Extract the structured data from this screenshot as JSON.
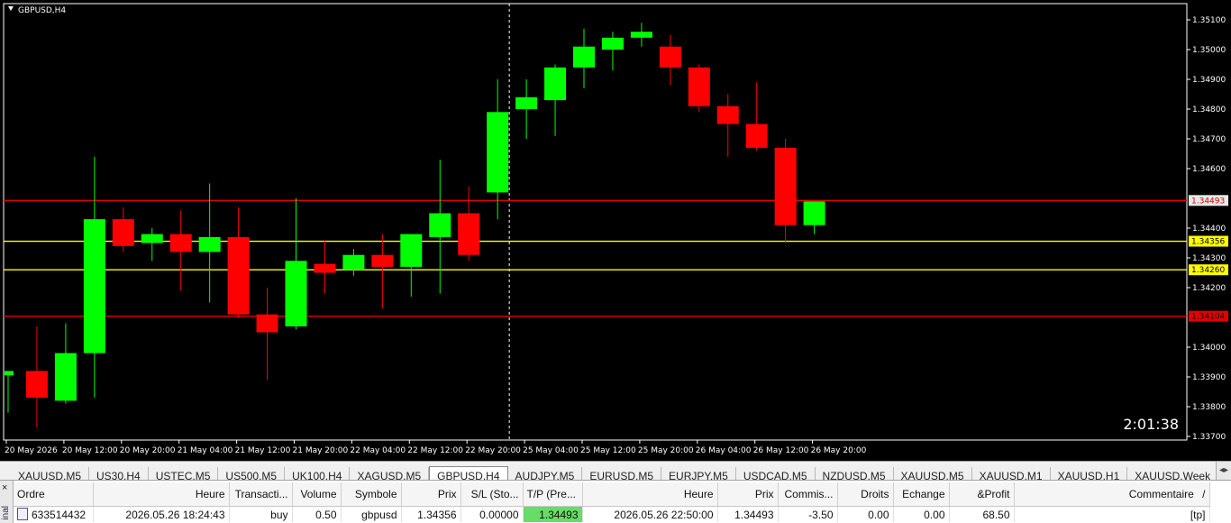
{
  "chart": {
    "symbol_label": "GBPUSD,H4",
    "countdown": "2:01:38",
    "price_labels": [
      "1.35100",
      "1.35000",
      "1.34900",
      "1.34800",
      "1.34700",
      "1.34600",
      "1.34400",
      "1.34300",
      "1.34200",
      "1.34000",
      "1.33900",
      "1.33800",
      "1.33700"
    ],
    "time_labels": [
      "20 May 2026",
      "20 May 12:00",
      "20 May 20:00",
      "21 May 04:00",
      "21 May 12:00",
      "21 May 20:00",
      "22 May 04:00",
      "22 May 12:00",
      "22 May 20:00",
      "25 May 04:00",
      "25 May 12:00",
      "25 May 20:00",
      "26 May 04:00",
      "26 May 12:00",
      "26 May 20:00"
    ],
    "levels": [
      {
        "label": "1.34493",
        "price": 1.34493,
        "color": "#e00000",
        "text_color": "#e00000",
        "bg": "#e8e8e8"
      },
      {
        "label": "1.34356",
        "price": 1.34356,
        "color": "#ffff00",
        "text_color": "#000000",
        "bg": "#ffff00"
      },
      {
        "label": "1.34260",
        "price": 1.3426,
        "color": "#ffff00",
        "text_color": "#000000",
        "bg": "#ffff00"
      },
      {
        "label": "1.34104",
        "price": 1.34104,
        "color": "#e00000",
        "text_color": "#000000",
        "bg": "#e00000"
      }
    ],
    "colors": {
      "bull": "#00ff00",
      "bear": "#ff0000",
      "background": "#000000",
      "axis_text": "#ffffff"
    },
    "candles": [
      [
        1.33905,
        1.3392,
        1.3378,
        1.3392
      ],
      [
        1.3392,
        1.3407,
        1.3373,
        1.3383
      ],
      [
        1.3382,
        1.3408,
        1.3381,
        1.3398
      ],
      [
        1.3398,
        1.3464,
        1.3383,
        1.3443
      ],
      [
        1.3443,
        1.3447,
        1.3432,
        1.3434
      ],
      [
        1.3435,
        1.344,
        1.3429,
        1.3438
      ],
      [
        1.3438,
        1.3446,
        1.3419,
        1.3432
      ],
      [
        1.3432,
        1.3455,
        1.3415,
        1.3437
      ],
      [
        1.3437,
        1.3447,
        1.341,
        1.3411
      ],
      [
        1.3411,
        1.342,
        1.3389,
        1.3405
      ],
      [
        1.3407,
        1.345,
        1.3406,
        1.3429
      ],
      [
        1.3428,
        1.3436,
        1.3418,
        1.3425
      ],
      [
        1.3426,
        1.3433,
        1.3424,
        1.3431
      ],
      [
        1.3431,
        1.3438,
        1.3413,
        1.3427
      ],
      [
        1.3427,
        1.3438,
        1.3417,
        1.3438
      ],
      [
        1.3437,
        1.3463,
        1.3418,
        1.3445
      ],
      [
        1.3445,
        1.3454,
        1.3429,
        1.3431
      ],
      [
        1.3452,
        1.349,
        1.3443,
        1.3479
      ],
      [
        1.348,
        1.349,
        1.347,
        1.3484
      ],
      [
        1.3483,
        1.3495,
        1.3471,
        1.3494
      ],
      [
        1.3494,
        1.3507,
        1.3487,
        1.3501
      ],
      [
        1.35,
        1.3506,
        1.3493,
        1.3504
      ],
      [
        1.3504,
        1.3509,
        1.3501,
        1.3506
      ],
      [
        1.3501,
        1.3505,
        1.3488,
        1.3494
      ],
      [
        1.3494,
        1.3495,
        1.3479,
        1.3481
      ],
      [
        1.3481,
        1.3485,
        1.3464,
        1.3475
      ],
      [
        1.3475,
        1.3489,
        1.3466,
        1.3467
      ],
      [
        1.3467,
        1.347,
        1.3435,
        1.3441
      ],
      [
        1.3441,
        1.3449,
        1.3438,
        1.3449
      ]
    ],
    "cursor_candle_index": 17
  },
  "tabs": [
    "XAUUSD,M5",
    "US30,H4",
    "USTEC,M5",
    "US500,M5",
    "UK100,H4",
    "XAGUSD,M5",
    "GBPUSD,H4",
    "AUDJPY,M5",
    "EURUSD,M5",
    "EURJPY,M5",
    "USDCAD,M5",
    "NZDUSD,M5",
    "XAUUSD,M5",
    "XAUUSD,M1",
    "XAUUSD,H1",
    "XAUUSD,Week"
  ],
  "active_tab": 6,
  "terminal": {
    "side_close": "×",
    "side_label": "inal",
    "columns": [
      "Ordre",
      "Heure",
      "Transacti...",
      "Volume",
      "Symbole",
      "Prix",
      "S/L (Sto...",
      "T/P (Pre...",
      "Heure",
      "Prix",
      "Commis...",
      "Droits",
      "Echange",
      "&Profit",
      "Commentaire"
    ],
    "sort_indicator": "/",
    "row": [
      "633514432",
      "2026.05.26 18:24:43",
      "buy",
      "0.50",
      "gbpusd",
      "1.34356",
      "0.00000",
      "1.34493",
      "2026.05.26 22:50:00",
      "1.34493",
      "-3.50",
      "0.00",
      "0.00",
      "68.50",
      "[tp]"
    ]
  }
}
